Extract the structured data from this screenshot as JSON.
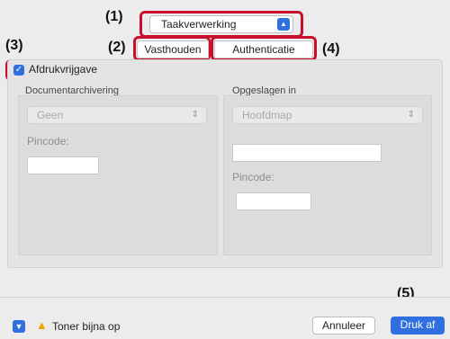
{
  "callouts": {
    "c1": "(1)",
    "c2": "(2)",
    "c3": "(3)",
    "c4": "(4)",
    "c5": "(5)"
  },
  "popup": {
    "value": "Taakverwerking",
    "icon": "chevron-updown-icon"
  },
  "tabs": [
    {
      "label": "Vasthouden",
      "selected": true
    },
    {
      "label": "Authenticatie",
      "selected": false
    }
  ],
  "release_checkbox": {
    "label": "Afdrukvrijgave",
    "checked": true
  },
  "document_storage": {
    "section_label": "Documentarchivering",
    "select_value": "Geen",
    "pin_label": "Pincode:"
  },
  "saved_in": {
    "section_label": "Opgeslagen in",
    "select_value": "Hoofdmap",
    "pin_label": "Pincode:"
  },
  "footer": {
    "warning_text": "Toner bijna op",
    "cancel_label": "Annuleer",
    "print_label": "Druk af"
  },
  "colors": {
    "accent": "#2f6fe0",
    "callout_border": "#c8102e",
    "warning": "#f0a500"
  }
}
